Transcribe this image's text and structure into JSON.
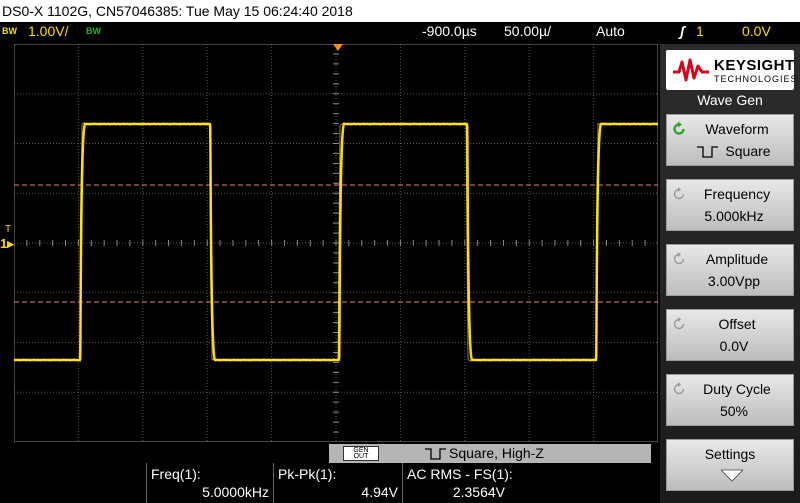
{
  "title_bar": {
    "text": "DS0-X 1102G, CN57046385: Tue May 15 06:24:40 2018"
  },
  "top_bar": {
    "bw1": "BW",
    "ch1_scale": "1.00V/",
    "bw2": "BW",
    "time_position": "-900.0µs",
    "time_scale": "50.00µ/",
    "trigger_mode": "Auto",
    "trigger_icon": "ʃ",
    "trigger_source": "1",
    "trigger_level": "0.0V"
  },
  "colors": {
    "channel1": "#ffd800",
    "channel2": "#18b818",
    "cursor": "#f08080",
    "softkey_bg": "#d0d0d0"
  },
  "screen": {
    "trigger_marker": "T",
    "channel_marker": "1",
    "waveform": {
      "shape": "square",
      "high_div": 3,
      "low_div": -1,
      "period_div": 5
    }
  },
  "sidebar": {
    "brand_name": "KEYSIGHT",
    "brand_sub": "TECHNOLOGIES",
    "menu_title": "Wave Gen",
    "softkeys": [
      {
        "label": "Waveform",
        "value": "Square",
        "icon": "rotate-icon",
        "active": true
      },
      {
        "label": "Frequency",
        "value": "5.000kHz",
        "icon": "rotate-icon",
        "active": false
      },
      {
        "label": "Amplitude",
        "value": "3.00Vpp",
        "icon": "rotate-icon",
        "active": false
      },
      {
        "label": "Offset",
        "value": "0.0V",
        "icon": "rotate-icon",
        "active": false
      },
      {
        "label": "Duty Cycle",
        "value": "50%",
        "icon": "rotate-icon",
        "active": false
      },
      {
        "label": "Settings",
        "value": "",
        "icon": "down-arrow-icon",
        "active": false
      }
    ]
  },
  "gen_bar": {
    "badge_line1": "GEN",
    "badge_line2": "OUT",
    "text": "Square, High-Z"
  },
  "measurements": [
    {
      "label": "Freq(1):",
      "value": "5.0000kHz"
    },
    {
      "label": "Pk-Pk(1):",
      "value": "4.94V"
    },
    {
      "label": "AC RMS - FS(1):",
      "value": "2.3564V"
    }
  ]
}
